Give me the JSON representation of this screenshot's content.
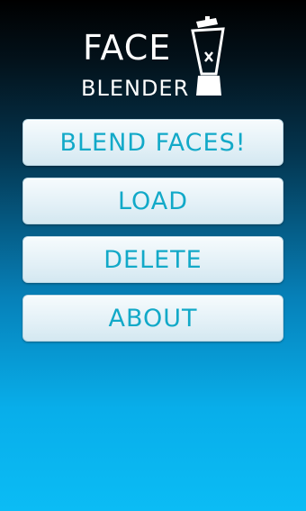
{
  "logo": {
    "line1": "FACE",
    "line2": "BLENDER"
  },
  "menu": {
    "items": [
      {
        "label": "BLEND FACES!"
      },
      {
        "label": "LOAD"
      },
      {
        "label": "DELETE"
      },
      {
        "label": "ABOUT"
      }
    ]
  },
  "colors": {
    "button_text": "#12a9c8",
    "button_bg": "#e4f1f7",
    "background_top": "#000000",
    "background_bottom": "#0bbcf5"
  },
  "icons": {
    "logo_icon": "blender-icon"
  }
}
